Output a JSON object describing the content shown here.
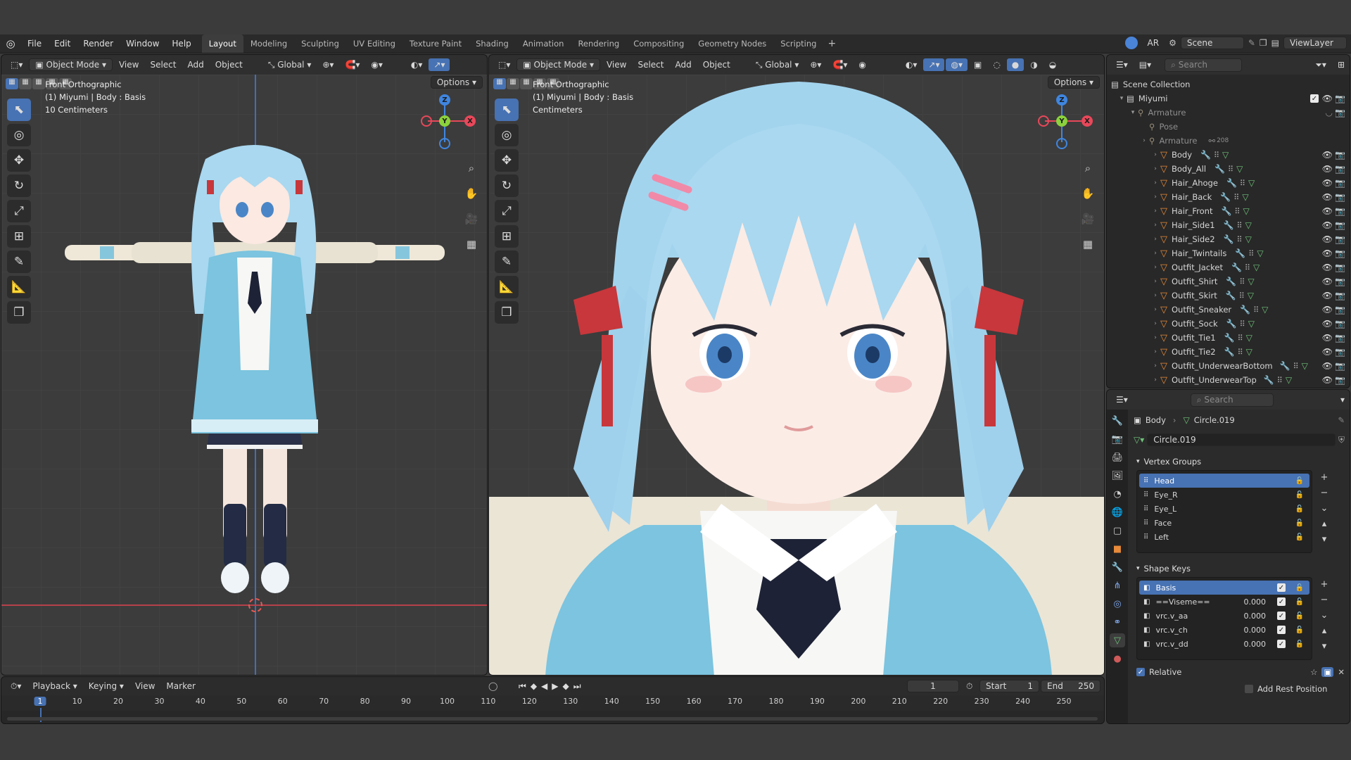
{
  "menu": [
    "File",
    "Edit",
    "Render",
    "Window",
    "Help"
  ],
  "workspaces": [
    {
      "label": "Layout",
      "active": true
    },
    {
      "label": "Modeling",
      "active": false
    },
    {
      "label": "Sculpting",
      "active": false
    },
    {
      "label": "UV Editing",
      "active": false
    },
    {
      "label": "Texture Paint",
      "active": false
    },
    {
      "label": "Shading",
      "active": false
    },
    {
      "label": "Animation",
      "active": false
    },
    {
      "label": "Rendering",
      "active": false
    },
    {
      "label": "Compositing",
      "active": false
    },
    {
      "label": "Geometry Nodes",
      "active": false
    },
    {
      "label": "Scripting",
      "active": false
    }
  ],
  "topright": {
    "ar": "AR",
    "scene": "Scene",
    "viewlayer": "ViewLayer"
  },
  "viewport_header": {
    "mode": "Object Mode",
    "view": "View",
    "select": "Select",
    "add": "Add",
    "object": "Object",
    "orientation": "Global",
    "options": "Options"
  },
  "vp_left": {
    "line1": "Front Orthographic",
    "line2": "(1) Miyumi | Body : Basis",
    "line3": "10 Centimeters"
  },
  "vp_right": {
    "line1": "Front Orthographic",
    "line2": "(1) Miyumi | Body : Basis",
    "line3": "Centimeters"
  },
  "gizmo": {
    "x": "X",
    "y": "Y",
    "z": "Z"
  },
  "outliner": {
    "search_placeholder": "Search",
    "scene_collection": "Scene Collection",
    "root": "Miyumi",
    "armature": "Armature",
    "pose": "Pose",
    "armature_data": "Armature",
    "armature_count": "208",
    "objects": [
      "Body",
      "Body_All",
      "Hair_Ahoge",
      "Hair_Back",
      "Hair_Front",
      "Hair_Side1",
      "Hair_Side2",
      "Hair_Twintails",
      "Outfit_Jacket",
      "Outfit_Shirt",
      "Outfit_Skirt",
      "Outfit_Sneaker",
      "Outfit_Sock",
      "Outfit_Tie1",
      "Outfit_Tie2",
      "Outfit_UnderwearBottom",
      "Outfit_UnderwearTop"
    ]
  },
  "properties": {
    "search_placeholder": "Search",
    "breadcrumb_object": "Body",
    "breadcrumb_data": "Circle.019",
    "mesh_name": "Circle.019",
    "vertex_groups_label": "Vertex Groups",
    "vertex_groups": [
      "Head",
      "Eye_R",
      "Eye_L",
      "Face",
      "Left"
    ],
    "shape_keys_label": "Shape Keys",
    "shape_keys": [
      {
        "name": "Basis",
        "value": ""
      },
      {
        "name": "==Viseme==",
        "value": "0.000"
      },
      {
        "name": "vrc.v_aa",
        "value": "0.000"
      },
      {
        "name": "vrc.v_ch",
        "value": "0.000"
      },
      {
        "name": "vrc.v_dd",
        "value": "0.000"
      }
    ],
    "relative_label": "Relative",
    "add_rest_label": "Add Rest Position"
  },
  "timeline": {
    "playback": "Playback",
    "keying": "Keying",
    "view": "View",
    "marker": "Marker",
    "current_frame": "1",
    "start_label": "Start",
    "start": "1",
    "end_label": "End",
    "end": "250",
    "ticks": [
      "1",
      "10",
      "20",
      "30",
      "40",
      "50",
      "60",
      "70",
      "80",
      "90",
      "100",
      "110",
      "120",
      "130",
      "140",
      "150",
      "160",
      "170",
      "180",
      "190",
      "200",
      "210",
      "220",
      "230",
      "240",
      "250"
    ]
  },
  "colors": {
    "accent": "#4772b3",
    "x_axis": "#e8485a",
    "y_axis": "#8bd23c",
    "z_axis": "#3f86e0",
    "hair": "#9fd3ef",
    "jacket": "#7cc4df",
    "ribbon": "#c8373b"
  }
}
